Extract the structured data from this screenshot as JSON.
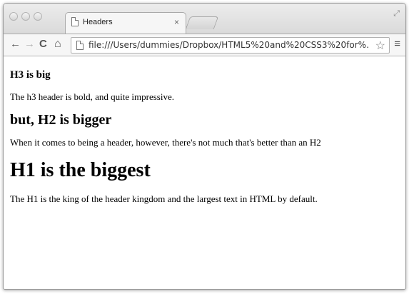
{
  "tab": {
    "title": "Headers",
    "close_glyph": "×"
  },
  "toolbar": {
    "back_glyph": "←",
    "forward_glyph": "→",
    "reload_glyph": "C",
    "home_glyph": "⌂",
    "url": "file:///Users/dummies/Dropbox/HTML5%20and%20CSS3%20for%…",
    "star_glyph": "☆",
    "menu_glyph": "≡"
  },
  "page": {
    "h3": "H3 is big",
    "p1": "The h3 header is bold, and quite impressive.",
    "h2": "but, H2 is bigger",
    "p2": "When it comes to being a header, however, there's not much that's better than an H2",
    "h1": "H1 is the biggest",
    "p3": "The H1 is the king of the header kingdom and the largest text in HTML by default."
  },
  "icons": [
    "close-window-icon",
    "minimize-window-icon",
    "zoom-window-icon",
    "page-icon",
    "tab-close-icon",
    "resize-icon",
    "back-icon",
    "forward-icon",
    "reload-icon",
    "home-icon",
    "bookmark-star-icon",
    "menu-icon"
  ]
}
